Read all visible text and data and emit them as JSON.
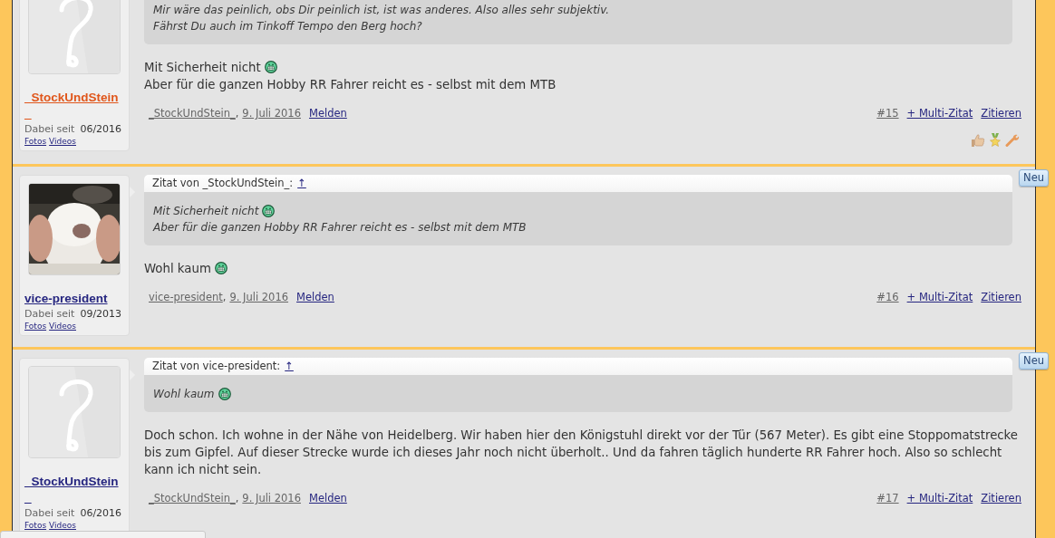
{
  "posts": [
    {
      "author": {
        "name": "_StockUndStein_",
        "color": "#e0561b",
        "avatar": {
          "kind": "placeholder"
        },
        "member_since_label": "Dabei seit",
        "member_since": "06/2016",
        "links": [
          "Fotos",
          "Videos"
        ]
      },
      "quote": {
        "lines": [
          {
            "text": "Mir wäre das peinlich, obs Dir peinlich ist, ist was anderes. Also alles sehr subjektiv.",
            "smiley": false
          },
          {
            "text": "Fährst Du auch im Tinkoff Tempo den Berg hoch?",
            "smiley": false
          }
        ]
      },
      "message": [
        {
          "text": "Mit Sicherheit nicht",
          "smiley": true
        },
        {
          "text": "Aber für die ganzen Hobby RR Fahrer reicht es - selbst mit dem MTB",
          "smiley": false
        }
      ],
      "footer": {
        "author": "_StockUndStein_",
        "separator": ",",
        "date": "9. Juli 2016",
        "report": "Melden",
        "number": "#15",
        "multi_quote": "+ Multi-Zitat",
        "quote": "Zitieren"
      },
      "action_icons": true
    },
    {
      "author": {
        "name": "vice-president",
        "color": "#262680",
        "avatar": {
          "kind": "picture"
        },
        "member_since_label": "Dabei seit",
        "member_since": "09/2013",
        "links": [
          "Fotos",
          "Videos"
        ]
      },
      "badge": "Neu",
      "quote": {
        "header": "Zitat von _StockUndStein_:",
        "jump": "↑",
        "lines": [
          {
            "text": "Mit Sicherheit nicht",
            "smiley": true
          },
          {
            "text": "Aber für die ganzen Hobby RR Fahrer reicht es - selbst mit dem MTB",
            "smiley": false
          }
        ]
      },
      "message": [
        {
          "text": "Wohl kaum",
          "smiley": true
        }
      ],
      "footer": {
        "author": "vice-president",
        "separator": ",",
        "date": "9. Juli 2016",
        "report": "Melden",
        "number": "#16",
        "multi_quote": "+ Multi-Zitat",
        "quote": "Zitieren"
      },
      "action_icons": false
    },
    {
      "author": {
        "name": "_StockUndStein_",
        "color": "#262680",
        "avatar": {
          "kind": "placeholder"
        },
        "member_since_label": "Dabei seit",
        "member_since": "06/2016",
        "links": [
          "Fotos",
          "Videos"
        ]
      },
      "badge": "Neu",
      "quote": {
        "header": "Zitat von vice-president:",
        "jump": "↑",
        "lines": [
          {
            "text": "Wohl kaum",
            "smiley": true
          }
        ]
      },
      "message": [
        {
          "text": "Doch schon. Ich wohne in der Nähe von Heidelberg. Wir haben hier den Königstuhl direkt vor der Tür (567 Meter). Es gibt eine Stoppomatstrecke bis zum Gipfel. Auf dieser Strecke wurde ich dieses Jahr noch nicht überholt.. Und da fahren täglich hunderte RR Fahrer hoch. Also so schlecht kann ich nicht sein.",
          "smiley": false
        }
      ],
      "footer": {
        "author": "_StockUndStein_",
        "separator": ",",
        "date": "9. Juli 2016",
        "report": "Melden",
        "number": "#17",
        "multi_quote": "+ Multi-Zitat",
        "quote": "Zitieren"
      },
      "action_icons": false
    }
  ]
}
